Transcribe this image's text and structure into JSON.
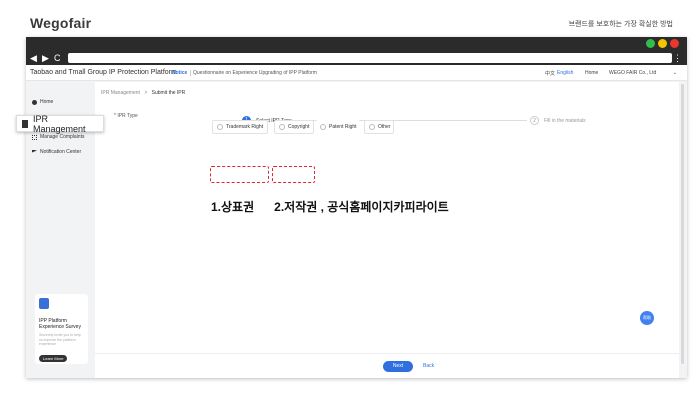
{
  "brand": {
    "logo": "Wegofair",
    "slogan": "브랜드를 보호하는 가장 확실한 방법"
  },
  "browser": {
    "nav": {
      "back": "◀",
      "forward": "▶",
      "reload": "C"
    },
    "menu_icon": "⋮",
    "dot_colors": [
      "#2fbf4a",
      "#f5c400",
      "#e8372c"
    ]
  },
  "appbar": {
    "title": "Taobao and Tmall Group IP Protection Platform",
    "notice_tag": "Notice",
    "notice_text": "Questionnaire on Experience Upgrading of IPP Platform",
    "lang_zh": "中文",
    "lang_en": "English",
    "home": "Home",
    "company": "WEGO FAIR Co., Ltd",
    "caret": "⌄"
  },
  "sidebar": {
    "items": [
      {
        "label": "Home",
        "icon": "home-icon"
      },
      {
        "label": "IPR Management",
        "icon": "document-icon"
      },
      {
        "label": "Manage Complaints",
        "icon": "grid-icon"
      },
      {
        "label": "Notification Center",
        "icon": "flag-icon"
      }
    ],
    "survey": {
      "title": "IPP Platform Experience Survey",
      "desc": "Sincerely invite you to help us improve the platform experience",
      "button": "Learn More"
    }
  },
  "main": {
    "breadcrumb": {
      "parent": "IPR Management",
      "separator": ">",
      "current": "Submit the IPR"
    },
    "steps": [
      {
        "num": "1",
        "label": "Select IPR Type"
      },
      {
        "num": "2",
        "label": "Fill in the materials"
      }
    ],
    "ipr_type_label": "* IPR Type",
    "ipr_options": [
      "Trademark Right",
      "Copyright",
      "Patent Right",
      "Other"
    ],
    "annotation": {
      "a": "1.상표권",
      "b": "2.저작권 , 공식홈페이지카피라이트"
    }
  },
  "footer": {
    "next": "Next",
    "back": "Back"
  },
  "help": {
    "label": "帮助"
  },
  "colors": {
    "accent": "#2f6fe0",
    "highlight": "#e0262e"
  }
}
